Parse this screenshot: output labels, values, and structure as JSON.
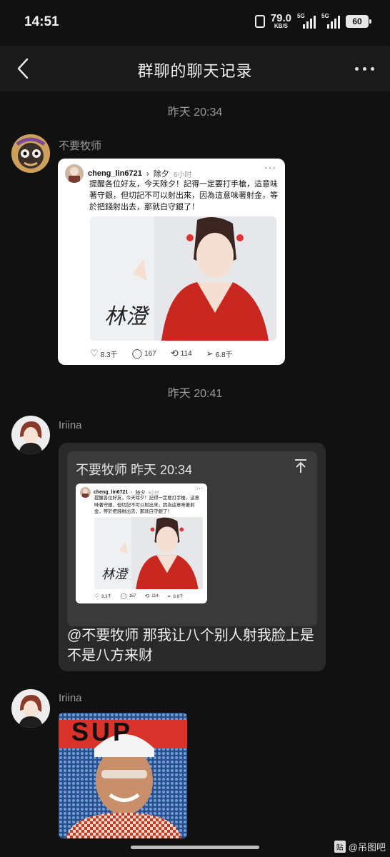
{
  "status_bar": {
    "time": "14:51",
    "net_speed_value": "79.0",
    "net_speed_unit": "KB/S",
    "sim1": "5G",
    "sim2": "5G",
    "battery": "60"
  },
  "header": {
    "title": "群聊的聊天记录"
  },
  "messages": [
    {
      "timestamp": "昨天 20:34",
      "sender": "不要牧师",
      "post": {
        "username": "cheng_lin6721",
        "channel": "除夕",
        "time": "6小时",
        "text": "提醒各位好友，今天除夕！記得一定要打手槍，這意味著守銀，但切記不可以射出來，因為這意味著射金，等於把錢射出去，那就白守銀了！",
        "signature": "林澄",
        "likes": "8.3千",
        "comments": "167",
        "reposts": "114",
        "shares": "6.8千"
      }
    },
    {
      "timestamp": "昨天 20:41",
      "sender": "Iriina",
      "quote_title": "不要牧师 昨天 20:34",
      "reply_text": "@不要牧师 那我让八个别人射我脸上是不是八方来财"
    },
    {
      "sender": "Iriina",
      "meme_text": "SUP"
    }
  ],
  "watermark": {
    "badge": "贴",
    "text": "@吊图吧"
  },
  "colors": {
    "background": "#111111",
    "header": "#1a1a1a",
    "bubble": "#2a2a2a",
    "quote": "#3a3a3a",
    "card": "#ffffff"
  }
}
